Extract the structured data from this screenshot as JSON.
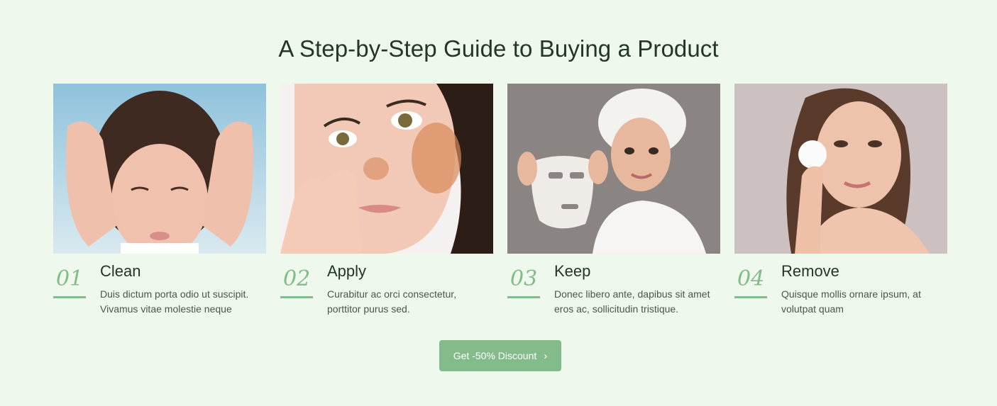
{
  "heading": "A Step-by-Step Guide to Buying a Product",
  "steps": [
    {
      "number": "01",
      "title": "Clean",
      "desc_line1": "Duis dictum porta odio ut suscipit.",
      "desc_line2": "Vivamus vitae molestie neque",
      "image": "woman-washing-face"
    },
    {
      "number": "02",
      "title": "Apply",
      "desc_line1": "Curabitur ac orci consectetur,",
      "desc_line2": "porttitor purus sed.",
      "image": "woman-applying-scrub"
    },
    {
      "number": "03",
      "title": "Keep",
      "desc_line1": "Donec libero ante, dapibus sit amet",
      "desc_line2": "eros ac, sollicitudin tristique.",
      "image": "woman-holding-sheet-mask"
    },
    {
      "number": "04",
      "title": "Remove",
      "desc_line1": "Quisque mollis ornare ipsum, at",
      "desc_line2": "volutpat quam",
      "image": "woman-using-cotton-pad"
    }
  ],
  "cta": {
    "label": "Get -50% Discount",
    "icon": "chevron-right-icon"
  },
  "colors": {
    "background": "#eef8ec",
    "accent": "#84bb8a",
    "heading": "#24352a"
  }
}
